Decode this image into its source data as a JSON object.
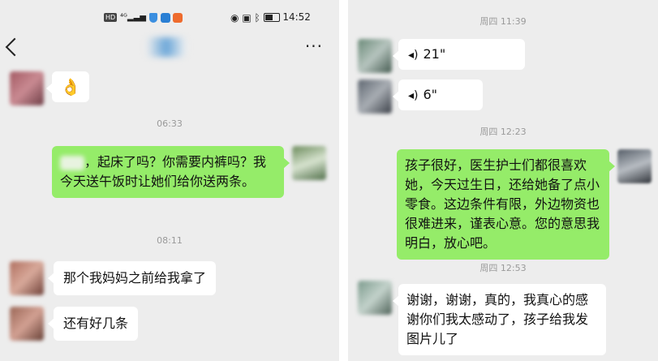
{
  "status_bar": {
    "time": "14:52"
  },
  "left_chat": {
    "emoji": "👌",
    "time1": "06:33",
    "msg_sent": "，起床了吗？你需要内裤吗？我今天送午饭时让她们给你送两条。",
    "time2": "08:11",
    "msg_recv1": "那个我妈妈之前给我拿了",
    "msg_recv2": "还有好几条"
  },
  "right_chat": {
    "time1": "周四 11:39",
    "voice1": "21\"",
    "voice2": "6\"",
    "time2": "周四 12:23",
    "msg_sent": "孩子很好，医生护士们都很喜欢她，今天过生日，还给她备了点小零食。这边条件有限，外边物资也很难进来，谨表心意。您的意思我明白，放心吧。",
    "time3": "周四 12:53",
    "msg_recv": "谢谢，谢谢，真的，我真心的感谢你们我太感动了，孩子给我发图片儿了"
  }
}
